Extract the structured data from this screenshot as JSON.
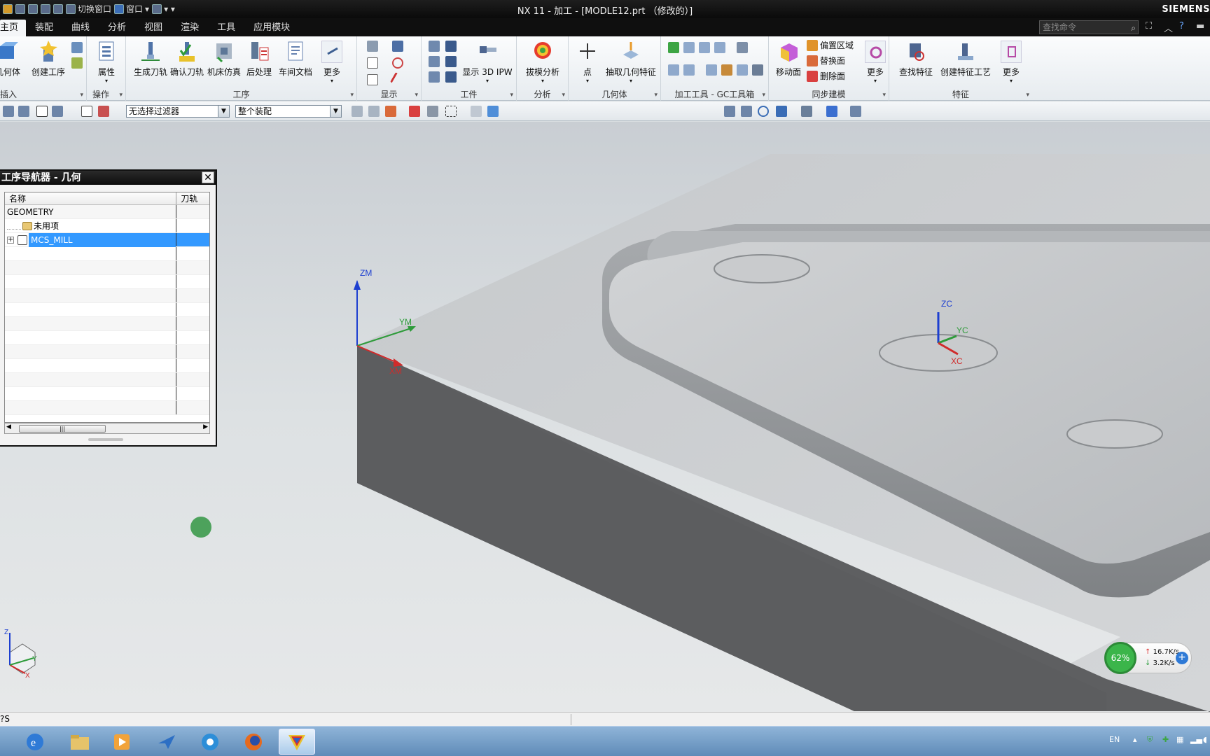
{
  "titlebar": {
    "qat": {
      "switch_window": "切换窗口",
      "window": "窗口"
    },
    "title": "NX 11 - 加工 - [MODLE12.prt （修改的）]",
    "brand": "SIEMENS"
  },
  "menubar": {
    "tabs": [
      "主页",
      "装配",
      "曲线",
      "分析",
      "视图",
      "渲染",
      "工具",
      "应用模块"
    ],
    "search_placeholder": "查找命令"
  },
  "ribbon": {
    "insert": {
      "geometry": "几何体",
      "create_op": "创建工序",
      "label": "插入"
    },
    "operations": {
      "properties": "属性",
      "label": "操作"
    },
    "procedure": {
      "generate": "生成刀轨",
      "verify": "确认刀轨",
      "simulate": "机床仿真",
      "postprocess": "后处理",
      "shop_doc": "车间文档",
      "more": "更多",
      "label": "工序"
    },
    "display": {
      "label": "显示"
    },
    "workpiece": {
      "show_ipw": "显示 3D IPW",
      "label": "工件"
    },
    "analysis": {
      "draft": "拔模分析",
      "label": "分析"
    },
    "geometry": {
      "point": "点",
      "extract": "抽取几何特征",
      "label": "几何体"
    },
    "gc_tools": {
      "label": "加工工具 - GC工具箱"
    },
    "sync": {
      "move_face": "移动面",
      "offset_region": "偏置区域",
      "replace_face": "替换面",
      "delete_face": "删除面",
      "more": "更多",
      "label": "同步建模"
    },
    "feature": {
      "find": "查找特征",
      "create_process": "创建特征工艺",
      "more": "更多",
      "label": "特征"
    }
  },
  "toolbar2": {
    "filter": "无选择过滤器",
    "scope": "整个装配"
  },
  "navigator": {
    "title": "工序导航器 - 几何",
    "columns": [
      "名称",
      "刀轨"
    ],
    "rows": [
      {
        "name": "GEOMETRY",
        "toolpath": ""
      },
      {
        "name": "未用项",
        "toolpath": ""
      },
      {
        "name": "MCS_MILL",
        "toolpath": ""
      }
    ]
  },
  "viewport": {
    "axes_machine": {
      "z": "ZM",
      "y": "YM",
      "x": "XM"
    },
    "axes_work": {
      "z": "ZC",
      "y": "YC",
      "x": "XC"
    },
    "triad": {
      "z": "Z",
      "y": "Y",
      "x": "X"
    }
  },
  "netwidget": {
    "percent": "62%",
    "up": "16.7K/s",
    "down": "3.2K/s"
  },
  "statusbar": {
    "text": "?S"
  },
  "tray": {
    "lang": "EN"
  }
}
